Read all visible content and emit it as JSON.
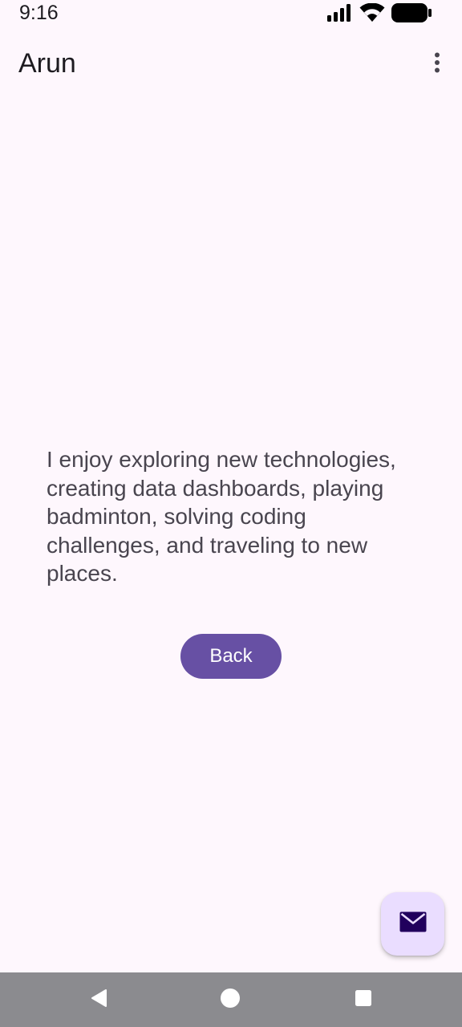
{
  "status_bar": {
    "time": "9:16",
    "icons": [
      "signal-icon",
      "wifi-icon",
      "battery-icon"
    ]
  },
  "app_bar": {
    "title": "Arun",
    "overflow_icon": "more-vert-icon"
  },
  "content": {
    "hobbies_text": "I enjoy exploring new technologies, creating data dashboards, playing badminton, solving coding challenges, and traveling to new places."
  },
  "actions": {
    "back_label": "Back"
  },
  "fab": {
    "icon": "mail-icon"
  },
  "navigation_bar": {
    "buttons": [
      "back-icon",
      "home-icon",
      "recents-icon"
    ]
  },
  "colors": {
    "background": "#FEF7FD",
    "primary": "#6750A4",
    "fab_container": "#EADDFF",
    "fab_icon": "#21005D",
    "body_text": "#49454F",
    "nav_bar": "#8B8B8F"
  }
}
